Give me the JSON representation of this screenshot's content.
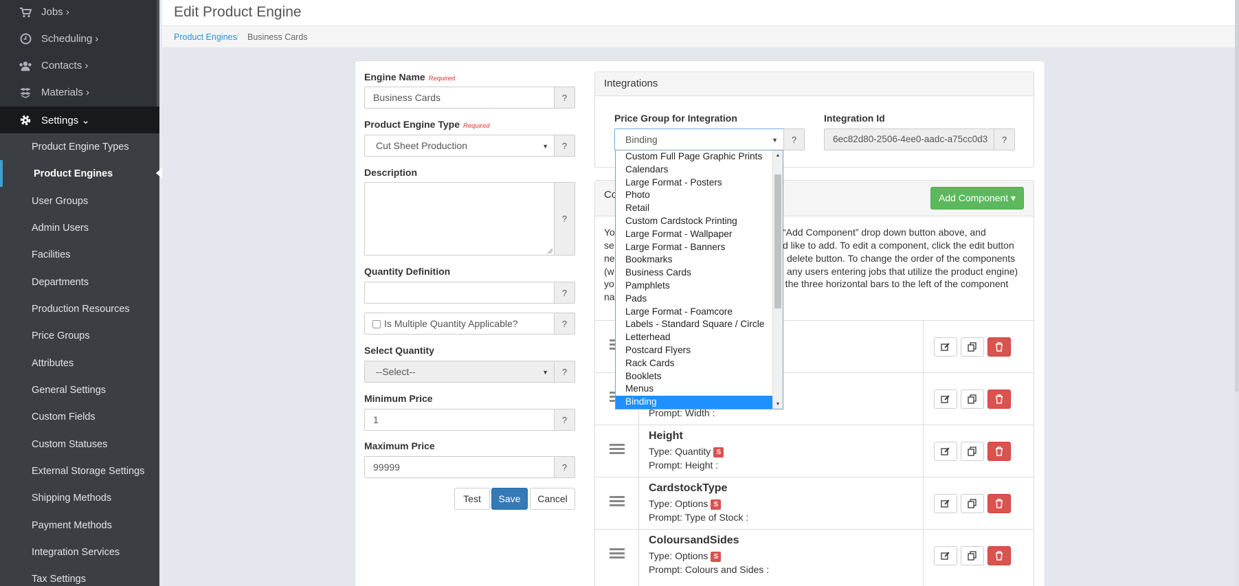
{
  "sidebar": {
    "top_items": [
      {
        "label": "Jobs ›",
        "icon": "cart-icon"
      },
      {
        "label": "Scheduling ›",
        "icon": "clock-icon"
      },
      {
        "label": "Contacts ›",
        "icon": "users-icon"
      },
      {
        "label": "Materials ›",
        "icon": "boxes-icon"
      },
      {
        "label": "Settings ⌄",
        "icon": "gear-icon"
      }
    ],
    "sub_items": [
      "Product Engine Types",
      "Product Engines",
      "User Groups",
      "Admin Users",
      "Facilities",
      "Departments",
      "Production Resources",
      "Price Groups",
      "Attributes",
      "General Settings",
      "Custom Fields",
      "Custom Statuses",
      "External Storage Settings",
      "Shipping Methods",
      "Payment Methods",
      "Integration Services",
      "Tax Settings"
    ],
    "active_sub": "Product Engines"
  },
  "header": {
    "title": "Edit Product Engine"
  },
  "breadcrumb": {
    "link": "Product Engines",
    "separator": "/",
    "current": "Business Cards"
  },
  "form": {
    "engine_name_label": "Engine Name",
    "required_text": "Required",
    "engine_name_value": "Business Cards",
    "type_label": "Product Engine Type",
    "type_value": "Cut Sheet Production",
    "description_label": "Description",
    "description_value": "",
    "quantity_def_label": "Quantity Definition",
    "quantity_def_value": "",
    "multiple_qty_label": "Is Multiple Quantity Applicable?",
    "select_qty_label": "Select Quantity",
    "select_qty_value": "--Select--",
    "min_price_label": "Minimum Price",
    "min_price_value": "1",
    "max_price_label": "Maximum Price",
    "max_price_value": "99999",
    "help": "?",
    "buttons": {
      "test": "Test",
      "save": "Save",
      "cancel": "Cancel"
    }
  },
  "integrations": {
    "title": "Integrations",
    "price_group_label": "Price Group for Integration",
    "price_group_value": "Binding",
    "integration_id_label": "Integration Id",
    "integration_id_value": "6ec82d80-2506-4ee0-aadc-a75cc0d3",
    "help": "?"
  },
  "dropdown_options": [
    "Custom Full Page Graphic Prints",
    "Calendars",
    "Large Format - Posters",
    "Photo",
    "Retail",
    "Custom Cardstock Printing",
    "Large Format - Wallpaper",
    "Large Format - Banners",
    "Bookmarks",
    "Business Cards",
    "Pamphlets",
    "Pads",
    "Large Format - Foamcore",
    "Labels - Standard Square / Circle",
    "Letterhead",
    "Postcard Flyers",
    "Rack Cards",
    "Booklets",
    "Menus",
    "Binding"
  ],
  "dropdown_selected": "Binding",
  "components": {
    "title_visible": "Co",
    "add_button": "Add Component ▾",
    "instructions": [
      "Yo",
      "“Add Component” drop down button above, and",
      "se",
      "d like to add. To edit a component, click the edit button",
      "ne",
      "delete button. To change the order of the components",
      "(w",
      "any users entering jobs that utilize the product engine)",
      "yo",
      "g the three horizontal bars to the left of the component",
      "na"
    ],
    "rows": [
      {
        "name": "",
        "type": "",
        "prompt": ""
      },
      {
        "name": "",
        "type": "",
        "prompt": "Prompt: Width :"
      },
      {
        "name": "Height",
        "type": "Type: Quantity",
        "prompt": "Prompt: Height :"
      },
      {
        "name": "CardstockType",
        "type": "Type: Options",
        "prompt": "Prompt: Type of Stock :"
      },
      {
        "name": "ColoursandSides",
        "type": "Type: Options",
        "prompt": "Prompt: Colours and Sides :"
      }
    ],
    "badge": "S"
  },
  "colors": {
    "sidebar_bg": "#2f3237",
    "sidebar_sub_bg": "#3b3e43",
    "accent_blue": "#337ab7",
    "success_green": "#5cb85c",
    "danger_red": "#d9534f",
    "dropdown_selected": "#1e90ff"
  }
}
